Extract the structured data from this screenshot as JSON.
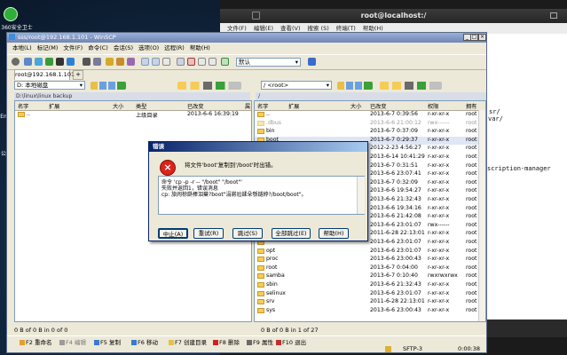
{
  "desktop": {
    "icons": [
      {
        "label": "360安全卫士"
      },
      {
        "label": "En"
      },
      {
        "label": "公"
      }
    ]
  },
  "terminal": {
    "title": "root@localhost:/",
    "menu": [
      "文件(F)",
      "编辑(E)",
      "查看(V)",
      "搜索 (S)",
      "终端(T)",
      "帮助(H)"
    ],
    "lines": [
      "sr/",
      "var/",
      "scription-manager"
    ]
  },
  "winscp": {
    "title": "sss/root@192.168.1.101 - WinSCP",
    "menu": [
      "本地(L)",
      "标记(M)",
      "文件(F)",
      "命令(C)",
      "会话(S)",
      "选项(O)",
      "远程(R)",
      "帮助(H)"
    ],
    "transfer_preset": "默认",
    "session_tab": "root@192.168.1.101",
    "left": {
      "drive": "D: 本地磁盘",
      "path": "D:\\linux\\linux backup",
      "columns": [
        "名字",
        "扩展",
        "大小",
        "类型",
        "已改变",
        "属"
      ],
      "rows": [
        {
          "name": "..",
          "type": "上级目录",
          "changed": "2013-6-6   16:39:19"
        }
      ],
      "status": "0 B of 0 B in 0 of 0"
    },
    "right": {
      "path": "/ <root>",
      "root_label": "/",
      "columns": [
        "名字",
        "扩展",
        "大小",
        "已改变",
        "权限",
        "拥有"
      ],
      "rows": [
        {
          "name": "..",
          "changed": "2013-6-7 0:39:56",
          "perm": "r-xr-xr-x",
          "owner": "root"
        },
        {
          "name": ".dbus",
          "changed": "2013-6-6 21:00:12",
          "perm": "rwx------",
          "owner": "root"
        },
        {
          "name": "bin",
          "changed": "2013-6-7 0:37:09",
          "perm": "r-xr-xr-x",
          "owner": "root"
        },
        {
          "name": "boot",
          "changed": "2013-6-7 0:29:37",
          "perm": "r-xr-xr-x",
          "owner": "root"
        },
        {
          "name": "",
          "changed": "2012-2-23 4:56:27",
          "perm": "r-xr-xr-x",
          "owner": "root"
        },
        {
          "name": "",
          "changed": "2013-6-14 10:41:29",
          "perm": "r-xr-xr-x",
          "owner": "root"
        },
        {
          "name": "",
          "changed": "2013-6-7 0:31:51",
          "perm": "r-xr-xr-x",
          "owner": "root"
        },
        {
          "name": "",
          "changed": "2013-6-6 23:07:41",
          "perm": "r-xr-xr-x",
          "owner": "root"
        },
        {
          "name": "",
          "changed": "2013-6-7 0:32:09",
          "perm": "r-xr-xr-x",
          "owner": "root"
        },
        {
          "name": "",
          "changed": "2013-6-6 19:54:27",
          "perm": "r-xr-xr-x",
          "owner": "root"
        },
        {
          "name": "",
          "changed": "2013-6-6 21:32:43",
          "perm": "r-xr-xr-x",
          "owner": "root"
        },
        {
          "name": "",
          "changed": "2013-6-6 19:34:16",
          "perm": "r-xr-xr-x",
          "owner": "root"
        },
        {
          "name": "",
          "changed": "2013-6-6 21:42:08",
          "perm": "r-xr-xr-x",
          "owner": "root"
        },
        {
          "name": "",
          "changed": "2013-6-6 23:01:07",
          "perm": "rwx------",
          "owner": "root"
        },
        {
          "name": "",
          "changed": "2011-6-28 22:13:01",
          "perm": "r-xr-xr-x",
          "owner": "root"
        },
        {
          "name": "",
          "changed": "2013-6-6 23:01:07",
          "perm": "r-xr-xr-x",
          "owner": "root"
        },
        {
          "name": "opt",
          "changed": "2013-6-6 23:01:07",
          "perm": "r-xr-xr-x",
          "owner": "root"
        },
        {
          "name": "proc",
          "changed": "2013-6-6 23:00:43",
          "perm": "r-xr-xr-x",
          "owner": "root"
        },
        {
          "name": "root",
          "changed": "2013-6-7 0:04:00",
          "perm": "r-xr-xr-x",
          "owner": "root"
        },
        {
          "name": "samba",
          "changed": "2013-6-7 0:10:40",
          "perm": "rwxrwxrwx",
          "owner": "root"
        },
        {
          "name": "sbin",
          "changed": "2013-6-6 21:32:43",
          "perm": "r-xr-xr-x",
          "owner": "root"
        },
        {
          "name": "selinux",
          "changed": "2013-6-6 23:01:07",
          "perm": "r-xr-xr-x",
          "owner": "root"
        },
        {
          "name": "srv",
          "changed": "2011-6-28 22:13:01",
          "perm": "r-xr-xr-x",
          "owner": "root"
        },
        {
          "name": "sys",
          "changed": "2013-6-6 23:00:43",
          "perm": "r-xr-xr-x",
          "owner": "root"
        }
      ],
      "status": "0 B of 0 B in 1 of 27"
    },
    "fkeys": [
      {
        "label": "F2 重命名",
        "color": "#e0a030"
      },
      {
        "label": "F4 编辑",
        "color": "#9a9a9a"
      },
      {
        "label": "F5 复制",
        "color": "#3a7ad0"
      },
      {
        "label": "F6 移动",
        "color": "#3a7ad0"
      },
      {
        "label": "F7 创建目录",
        "color": "#e8c048"
      },
      {
        "label": "F8 删除",
        "color": "#d02020"
      },
      {
        "label": "F9 属性",
        "color": "#6a6a6a"
      },
      {
        "label": "F10 退出",
        "color": "#c03030"
      }
    ],
    "protocol": "SFTP-3",
    "elapsed": "0:00:38"
  },
  "dialog": {
    "title": "错误",
    "message": "将文件'boot'复制到'/boot'时出错。",
    "details": [
      "命令 'cp -p -r -- \"/boot\" \"/boot\"'",
      "失败并返回1，错误消息",
      "cp: 旅闹椋瓞棒泪棄?boot\"涓嶈兘鍒朵綔鐩綍?/boot/boot\"。"
    ],
    "buttons": [
      "中止(A)",
      "重试(R)",
      "跳过(S)",
      "全部跳过(E)",
      "帮助(H)"
    ]
  }
}
